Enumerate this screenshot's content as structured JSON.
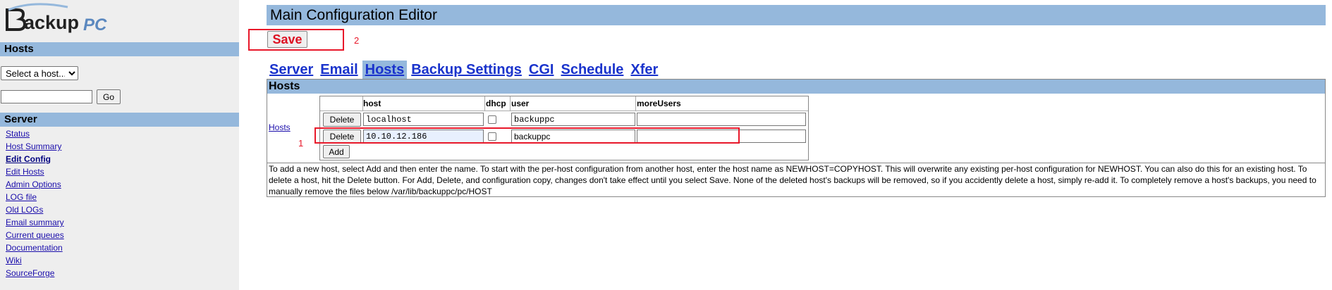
{
  "sidebar": {
    "logo": {
      "letter": "B",
      "main": "ackup",
      "suffix": "PC"
    },
    "hosts_heading": "Hosts",
    "host_select_value": "Select a host...",
    "go_label": "Go",
    "server_heading": "Server",
    "server_links": [
      "Status",
      "Host Summary",
      "Edit Config",
      "Edit Hosts",
      "Admin Options",
      "LOG file",
      "Old LOGs",
      "Email summary",
      "Current queues",
      "Documentation",
      "Wiki",
      "SourceForge"
    ],
    "current_link_index": 2
  },
  "main": {
    "title": "Main Configuration Editor",
    "save_label": "Save",
    "annotation_save": "2",
    "annotation_row": "1",
    "tabs": [
      "Server",
      "Email",
      "Hosts",
      "Backup Settings",
      "CGI",
      "Schedule",
      "Xfer"
    ],
    "active_tab": "Hosts",
    "hosts_section": {
      "heading": "Hosts",
      "left_link": "Hosts",
      "columns": [
        "host",
        "dhcp",
        "user",
        "moreUsers"
      ],
      "delete_label": "Delete",
      "add_label": "Add",
      "rows": [
        {
          "host": "localhost",
          "dhcp": false,
          "user": "backuppc",
          "moreUsers": ""
        },
        {
          "host": "10.10.12.186",
          "dhcp": false,
          "user": "backuppc",
          "moreUsers": ""
        }
      ],
      "help": "To add a new host, select Add and then enter the name. To start with the per-host configuration from another host, enter the host name as NEWHOST=COPYHOST. This will overwrite any existing per-host configuration for NEWHOST. You can also do this for an existing host. To delete a host, hit the Delete button. For Add, Delete, and configuration copy, changes don't take effect until you select Save. None of the deleted host's backups will be removed, so if you accidently delete a host, simply re-add it. To completely remove a host's backups, you need to manually remove the files below /var/lib/backuppc/pc/HOST"
    }
  },
  "colors": {
    "header_bg": "#95b8dc",
    "sidebar_bg": "#eeeeee",
    "annotation_red": "#e8182a",
    "tab_link": "#1a33cc"
  }
}
